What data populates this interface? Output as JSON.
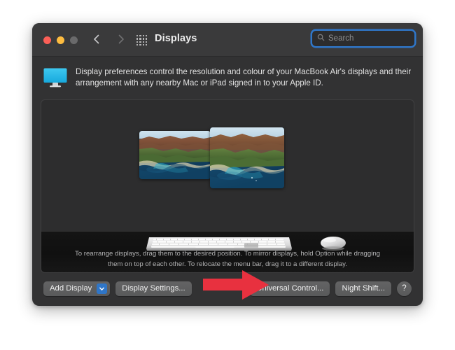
{
  "window": {
    "title": "Displays",
    "traffic_lights": [
      {
        "name": "close",
        "color": "#fb5f57"
      },
      {
        "name": "minimize",
        "color": "#fdbc40"
      },
      {
        "name": "zoom",
        "color": "#6a6a6b"
      }
    ],
    "nav": {
      "back_icon": "chevron-left-icon",
      "forward_icon": "chevron-right-icon",
      "grid_icon": "show-all-grid-icon"
    }
  },
  "search": {
    "placeholder": "Search",
    "value": "",
    "icon": "search-icon",
    "focus_ring_color": "#2f76c8"
  },
  "blurb": {
    "icon": "display-preferences-icon",
    "text": "Display preferences control the resolution and colour of your MacBook Air's displays and their arrangement with any nearby Mac or iPad signed in to your Apple ID."
  },
  "arrangement": {
    "displays": [
      {
        "name": "display-thumbnail-left",
        "label": ""
      },
      {
        "name": "display-thumbnail-right",
        "label": ""
      }
    ],
    "devices": [
      {
        "name": "keyboard-illustration"
      },
      {
        "name": "mouse-illustration"
      }
    ],
    "hint": "To rearrange displays, drag them to the desired position. To mirror displays, hold Option while dragging them on top of each other. To relocate the menu bar, drag it to a different display."
  },
  "bottom_bar": {
    "add_display_label": "Add Display",
    "add_display_chevron_icon": "chevron-down-icon",
    "add_display_chevron_color": "#2f76c8",
    "display_settings_label": "Display Settings...",
    "universal_control_label": "Universal Control...",
    "night_shift_label": "Night Shift...",
    "help_label": "?"
  },
  "annotation": {
    "arrow_icon": "red-arrow-right-icon",
    "arrow_color": "#e8313f",
    "points_at": "Universal Control..."
  },
  "colors": {
    "window_bg": "#323233",
    "titlebar_bg": "#3a3a3b",
    "panel_bg": "#2d2d2e",
    "accent": "#2f76c8",
    "page_bg": "#ffffff"
  }
}
